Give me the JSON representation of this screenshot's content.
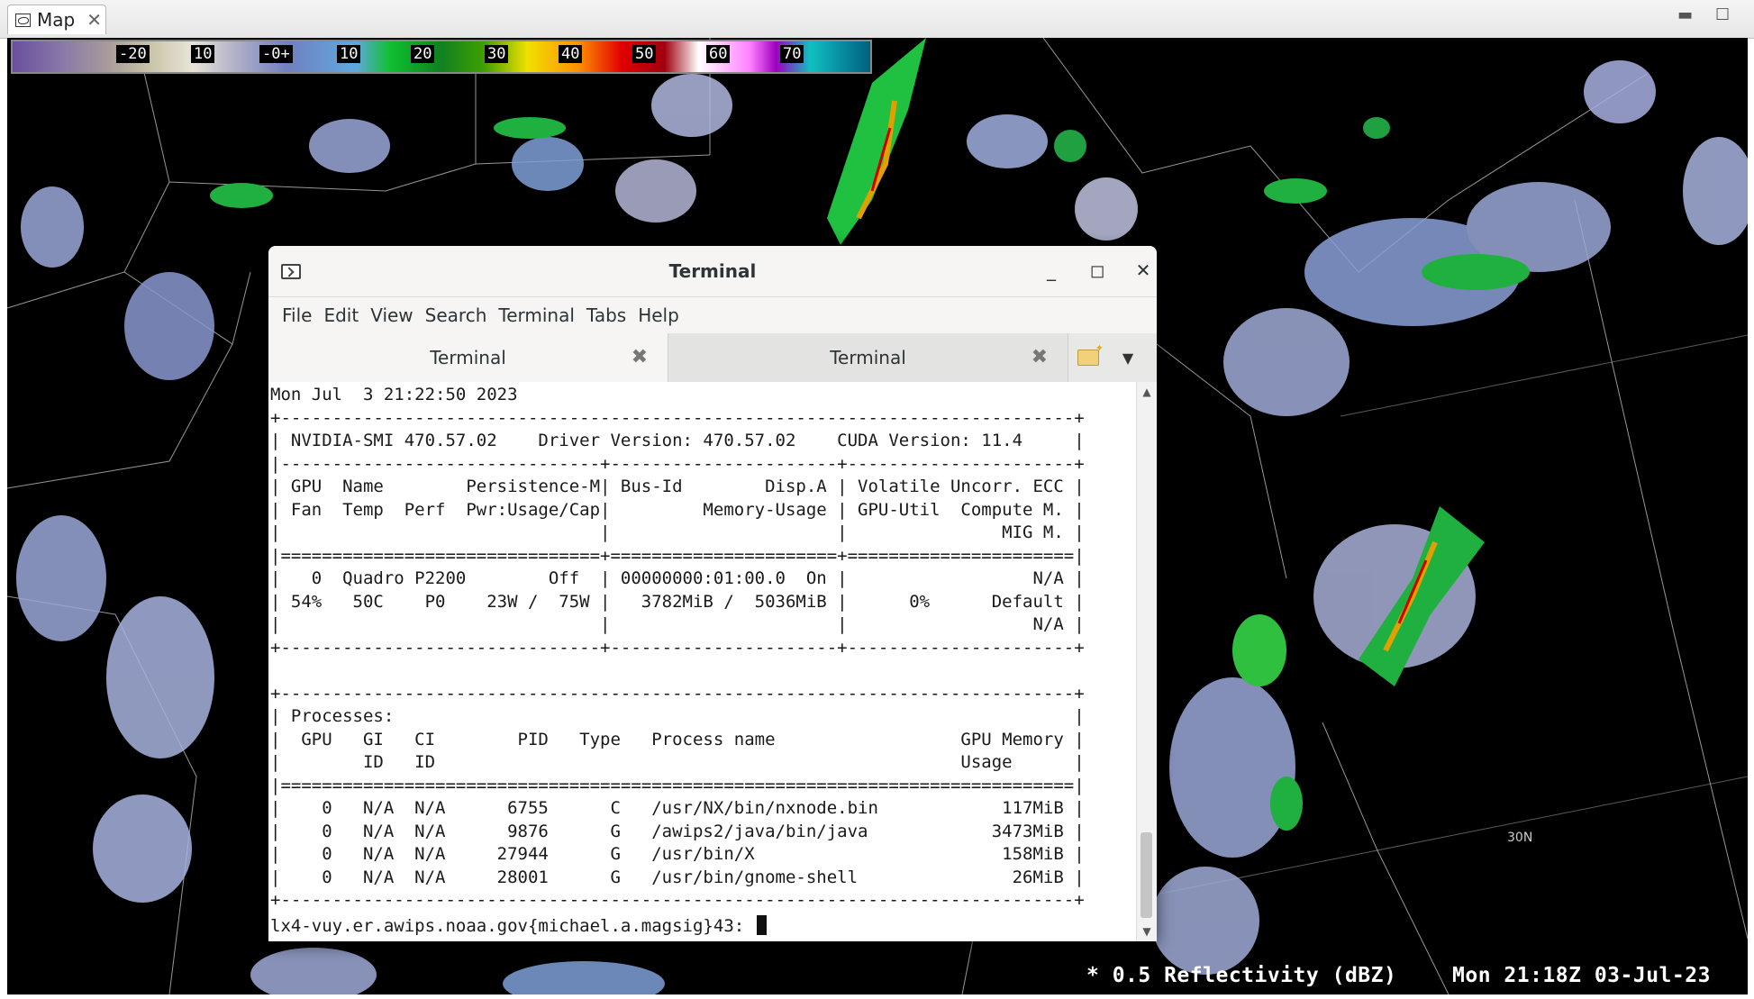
{
  "view": {
    "tab_label": "Map",
    "tab_icon": "map-view-icon"
  },
  "colorbar": {
    "labels": [
      "-20",
      "10",
      "-0+",
      "10",
      "20",
      "30",
      "40",
      "50",
      "60",
      "70"
    ]
  },
  "map": {
    "readout_product": "* 0.5 Reflectivity (dBZ)",
    "readout_time": "Mon 21:18Z 03-Jul-23",
    "lat_label": "30N"
  },
  "terminal": {
    "title": "Terminal",
    "menu": [
      "File",
      "Edit",
      "View",
      "Search",
      "Terminal",
      "Tabs",
      "Help"
    ],
    "tabs": [
      {
        "label": "Terminal",
        "active": true
      },
      {
        "label": "Terminal",
        "active": false
      }
    ],
    "output": "Mon Jul  3 21:22:50 2023\n+-----------------------------------------------------------------------------+\n| NVIDIA-SMI 470.57.02    Driver Version: 470.57.02    CUDA Version: 11.4     |\n|-------------------------------+----------------------+----------------------+\n| GPU  Name        Persistence-M| Bus-Id        Disp.A | Volatile Uncorr. ECC |\n| Fan  Temp  Perf  Pwr:Usage/Cap|         Memory-Usage | GPU-Util  Compute M. |\n|                               |                      |               MIG M. |\n|===============================+======================+======================|\n|   0  Quadro P2200        Off  | 00000000:01:00.0  On |                  N/A |\n| 54%   50C    P0    23W /  75W |   3782MiB /  5036MiB |      0%      Default |\n|                               |                      |                  N/A |\n+-------------------------------+----------------------+----------------------+\n\n+-----------------------------------------------------------------------------+\n| Processes:                                                                  |\n|  GPU   GI   CI        PID   Type   Process name                  GPU Memory |\n|        ID   ID                                                   Usage      |\n|=============================================================================|\n|    0   N/A  N/A      6755      C   /usr/NX/bin/nxnode.bin            117MiB |\n|    0   N/A  N/A      9876      G   /awips2/java/bin/java            3473MiB |\n|    0   N/A  N/A     27944      G   /usr/bin/X                        158MiB |\n|    0   N/A  N/A     28001      G   /usr/bin/gnome-shell               26MiB |\n+-----------------------------------------------------------------------------+",
    "prompt": "lx4-vuy.er.awips.noaa.gov{michael.a.magsig}43: "
  }
}
